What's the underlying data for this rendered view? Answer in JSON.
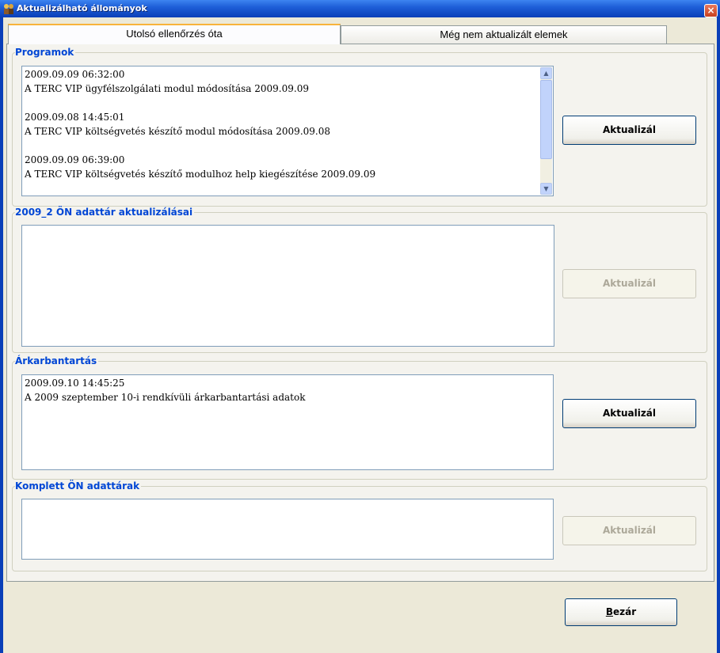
{
  "window": {
    "title": "Aktualizálható állományok",
    "close_glyph": "×"
  },
  "tabs": [
    {
      "label": "Utolsó ellenőrzés óta",
      "active": true
    },
    {
      "label": "Még nem aktualizált elemek",
      "active": false
    }
  ],
  "groups": {
    "programok": {
      "title": "Programok",
      "items": [
        {
          "time": "2009.09.09 06:32:00",
          "text": "A TERC VIP ügyfélszolgálati modul módosítása 2009.09.09"
        },
        {
          "time": "2009.09.08 14:45:01",
          "text": "A TERC VIP költségvetés készítő modul módosítása 2009.09.08"
        },
        {
          "time": "2009.09.09 06:39:00",
          "text": "A TERC VIP költségvetés készítő modulhoz help kiegészítése 2009.09.09"
        }
      ],
      "button": {
        "label": "Aktualizál",
        "enabled": true
      }
    },
    "adattar": {
      "title": "2009_2 ÖN adattár aktualizálásai",
      "items": [],
      "button": {
        "label": "Aktualizál",
        "enabled": false
      }
    },
    "arkarbantartas": {
      "title": "Árkarbantartás",
      "items": [
        {
          "time": "2009.09.10 14:45:25",
          "text": "A 2009 szeptember 10-i rendkívüli árkarbantartási adatok"
        }
      ],
      "button": {
        "label": "Aktualizál",
        "enabled": true
      }
    },
    "komplett": {
      "title": "Komplett ÖN adattárak",
      "items": [],
      "button": {
        "label": "Aktualizál",
        "enabled": false
      }
    }
  },
  "footer": {
    "close_label_mnemonic": "B",
    "close_label_rest": "ezár"
  },
  "colors": {
    "titlebar": "#0A3FB8",
    "group_title": "#0046D5",
    "tab_highlight": "#F8B33A"
  },
  "icons": {
    "app": "people-icon",
    "close": "close-icon",
    "scroll_up": "arrow-up-icon",
    "scroll_down": "arrow-down-icon"
  }
}
